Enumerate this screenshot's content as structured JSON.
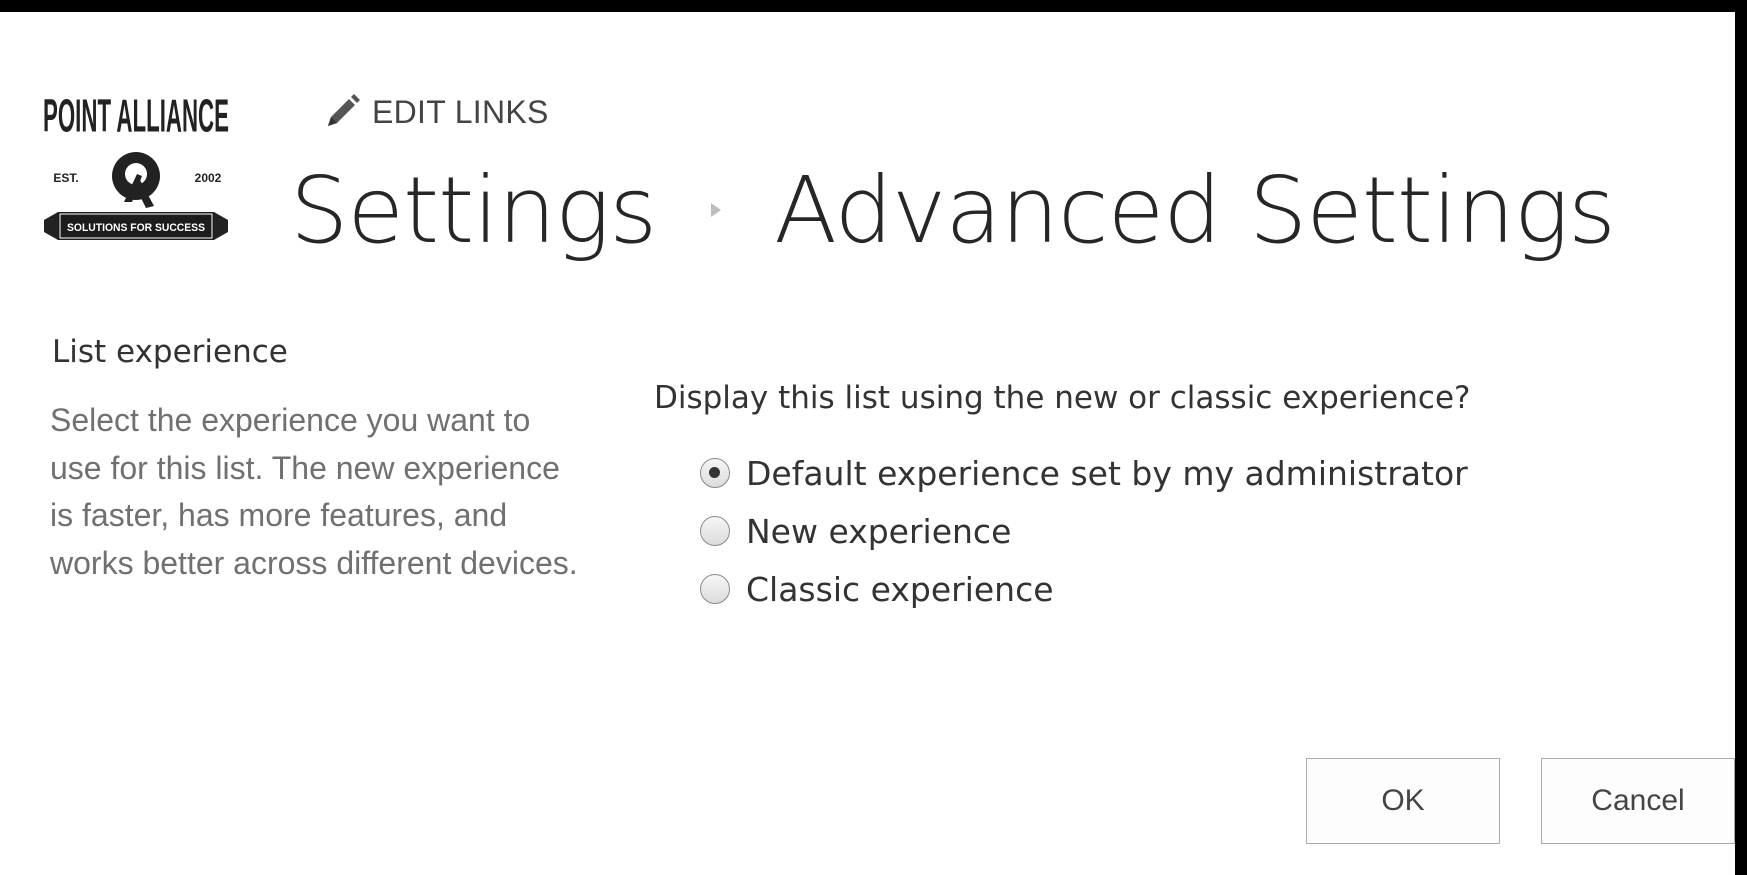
{
  "logo": {
    "top_text": "POINT ALLIANCE",
    "est_label": "EST.",
    "year": "2002",
    "banner_text": "SOLUTIONS FOR SUCCESS"
  },
  "header": {
    "edit_links_label": "EDIT LINKS",
    "edit_links_icon": "pencil-icon",
    "breadcrumb": [
      "Settings",
      "Advanced Settings"
    ],
    "separator_icon": "breadcrumb-arrow-icon"
  },
  "section": {
    "title": "List experience",
    "description": "Select the experience you want to use for this list. The new experience is faster, has more features, and works better across different devices."
  },
  "form": {
    "question": "Display this list using the new or classic experience?",
    "options": [
      {
        "label": "Default experience set by my administrator",
        "selected": true
      },
      {
        "label": "New experience",
        "selected": false
      },
      {
        "label": "Classic experience",
        "selected": false
      }
    ]
  },
  "buttons": {
    "ok": "OK",
    "cancel": "Cancel"
  }
}
